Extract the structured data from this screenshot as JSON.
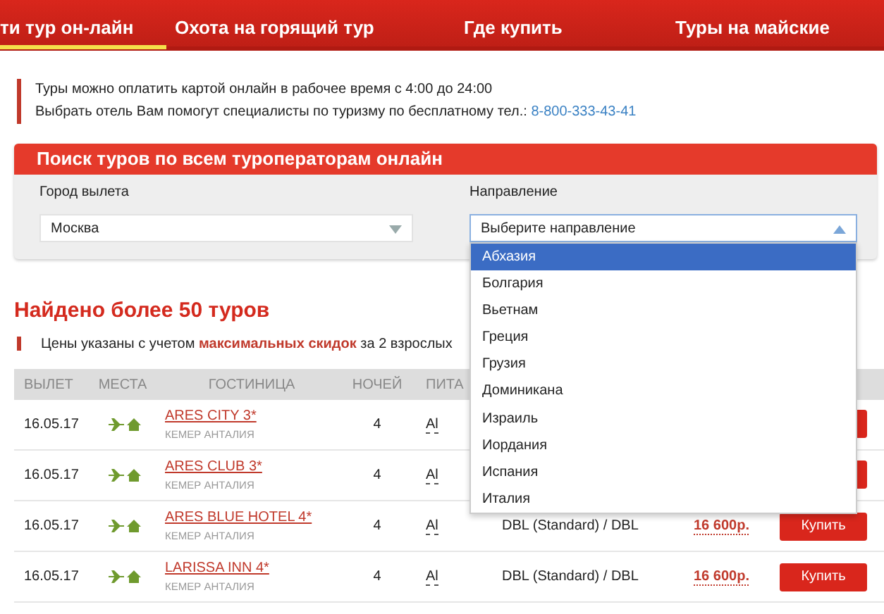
{
  "nav": {
    "tabs": [
      {
        "label": "ти тур он-лайн",
        "selected": true
      },
      {
        "label": "Охота на горящий тур",
        "selected": false
      },
      {
        "label": "Где купить",
        "selected": false
      },
      {
        "label": "Туры на майские",
        "selected": false
      }
    ]
  },
  "notice": {
    "line1": "Туры можно оплатить картой онлайн в рабочее время с 4:00 до 24:00",
    "line2": "Выбрать отель Вам помогут специалисты по туризму по бесплатному тел.:",
    "phone": "8-800-333-43-41"
  },
  "search": {
    "title": "Поиск туров по всем туроператорам онлайн",
    "departure": {
      "label": "Город вылета",
      "value": "Москва",
      "expanded": false
    },
    "destination": {
      "label": "Направление",
      "value": "Выберите направление",
      "expanded": true,
      "options": [
        {
          "label": "Абхазия",
          "selected": true
        },
        {
          "label": "Болгария",
          "selected": false
        },
        {
          "label": "Вьетнам",
          "selected": false
        },
        {
          "label": "Греция",
          "selected": false
        },
        {
          "label": "Грузия",
          "selected": false
        },
        {
          "label": "Доминикана",
          "selected": false
        },
        {
          "label": "Израиль",
          "selected": false
        },
        {
          "label": "Иордания",
          "selected": false
        },
        {
          "label": "Испания",
          "selected": false
        },
        {
          "label": "Италия",
          "selected": false
        }
      ]
    }
  },
  "results": {
    "heading": "Найдено более 50 туров",
    "note": "Цены указаны с учетом **максимальных скидок** за 2 взрослых"
  },
  "table": {
    "columns": [
      "ВЫЛЕТ",
      "МЕСТА",
      "ГОСТИНИЦА",
      "НОЧЕЙ",
      "ПИТА"
    ],
    "rows": [
      {
        "date": "16.05.17",
        "hotel": "ARES CITY 3*",
        "location": "КЕМЕР АНТАЛИЯ",
        "nights": "4",
        "meal": "Al"
      },
      {
        "date": "16.05.17",
        "hotel": "ARES CLUB 3*",
        "location": "КЕМЕР АНТАЛИЯ",
        "nights": "4",
        "meal": "Al"
      },
      {
        "date": "16.05.17",
        "hotel": "ARES BLUE HOTEL 4*",
        "location": "КЕМЕР АНТАЛИЯ",
        "nights": "4",
        "meal": "Al",
        "room": "DBL (Standard) / DBL",
        "price": "16 600р.",
        "buy": "Купить"
      },
      {
        "date": "16.05.17",
        "hotel": "LARISSA INN 4*",
        "location": "КЕМЕР АНТАЛИЯ",
        "nights": "4",
        "meal": "Al",
        "room": "DBL (Standard) / DBL",
        "price": "16 600р.",
        "buy": "Купить"
      }
    ]
  }
}
